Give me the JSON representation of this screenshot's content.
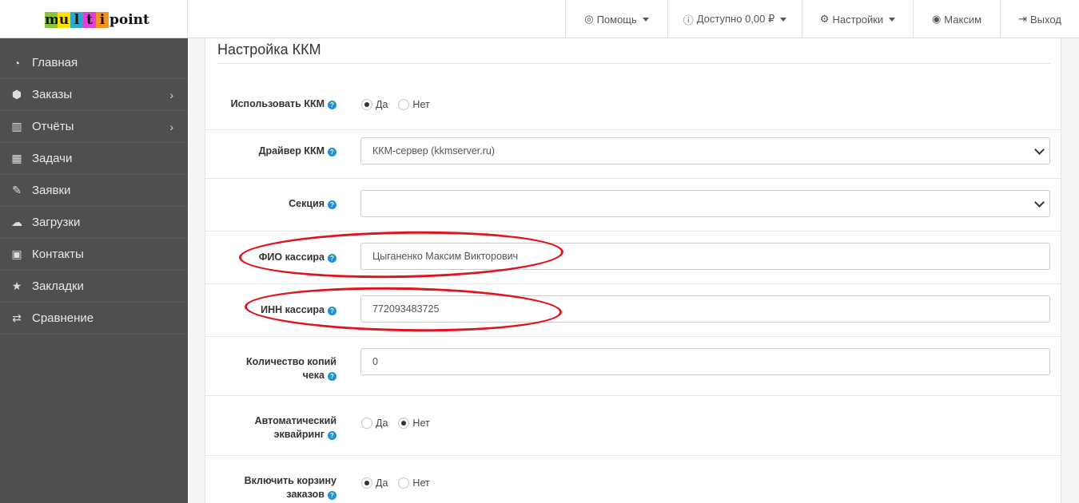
{
  "logo": {
    "letters": [
      {
        "char": "m",
        "color": "#8cc63f"
      },
      {
        "char": "u",
        "color": "#ffe000"
      },
      {
        "char": "l",
        "color": "#2aa9c9"
      },
      {
        "char": "t",
        "color": "#e040d8"
      },
      {
        "char": "i",
        "color": "#f7941d"
      }
    ],
    "rest": "point"
  },
  "topnav": {
    "help": "Помощь",
    "balance": "Доступно 0,00 ₽",
    "settings": "Настройки",
    "user": "Максим",
    "logout": "Выход"
  },
  "sidebar": {
    "items": [
      {
        "label": "Главная",
        "icon": "dashboard-icon",
        "glyph": "◔"
      },
      {
        "label": "Заказы",
        "icon": "cube-icon",
        "glyph": "⬢",
        "chevron": true
      },
      {
        "label": "Отчёты",
        "icon": "bar-chart-icon",
        "glyph": "▥",
        "chevron": true
      },
      {
        "label": "Задачи",
        "icon": "calendar-icon",
        "glyph": "▦"
      },
      {
        "label": "Заявки",
        "icon": "edit-icon",
        "glyph": "✎"
      },
      {
        "label": "Загрузки",
        "icon": "cloud-download-icon",
        "glyph": "☁"
      },
      {
        "label": "Контакты",
        "icon": "address-book-icon",
        "glyph": "▣"
      },
      {
        "label": "Закладки",
        "icon": "star-icon",
        "glyph": "★"
      },
      {
        "label": "Сравнение",
        "icon": "exchange-icon",
        "glyph": "⇄"
      }
    ]
  },
  "page": {
    "title": "Настройка ККМ"
  },
  "form": {
    "use_kkm": {
      "label": "Использовать ККМ",
      "yes": "Да",
      "no": "Нет",
      "selected": "yes"
    },
    "driver": {
      "label": "Драйвер ККМ",
      "value": "ККМ-сервер (kkmserver.ru)"
    },
    "section": {
      "label": "Секция",
      "value": ""
    },
    "cashier_name": {
      "label": "ФИО кассира",
      "value": "Цыганенко Максим Викторович"
    },
    "cashier_inn": {
      "label": "ИНН кассира",
      "value": "772093483725"
    },
    "copies": {
      "label_line1": "Количество копий",
      "label_line2": "чека",
      "value": "0"
    },
    "auto_acquiring": {
      "label_line1": "Автоматический",
      "label_line2": "эквайринг",
      "yes": "Да",
      "no": "Нет",
      "selected": "no"
    },
    "orders_cart": {
      "label_line1": "Включить корзину",
      "label_line2": "заказов",
      "yes": "Да",
      "no": "Нет",
      "selected": "yes"
    }
  },
  "colors": {
    "sidebar_bg": "#4f4f4f",
    "help_icon": "#1e91cf",
    "annotation": "#e0141e"
  }
}
